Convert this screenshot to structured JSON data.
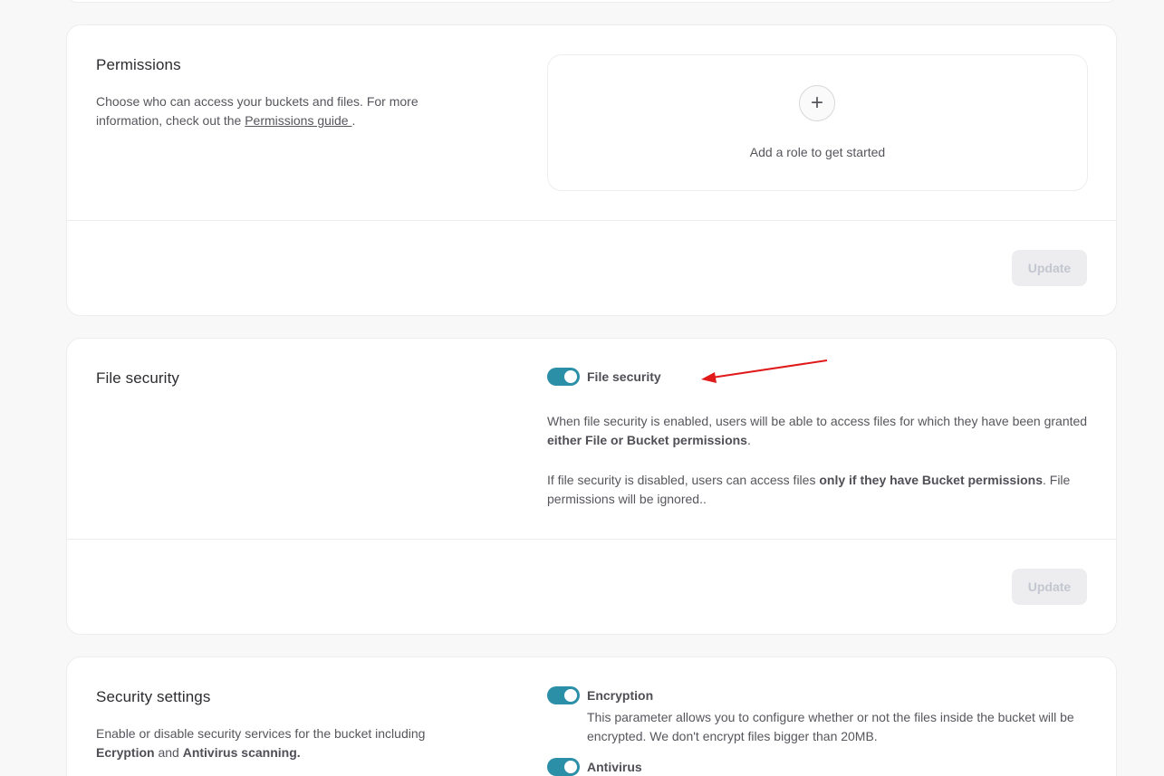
{
  "permissions": {
    "title": "Permissions",
    "desc_prefix": "Choose who can access your buckets and files. For more information, check out the ",
    "guide_link": "Permissions guide ",
    "desc_suffix": ".",
    "add_icon": "+",
    "empty_text": "Add a role to get started",
    "update_label": "Update"
  },
  "file_security": {
    "title": "File security",
    "toggle_label": "File security",
    "toggle_on": true,
    "p1_prefix": "When file security is enabled, users will be able to access files for which they have been granted ",
    "p1_bold": "either File or Bucket permissions",
    "p1_suffix": ".",
    "p2_prefix": "If file security is disabled, users can access files ",
    "p2_bold": "only if they have Bucket permissions",
    "p2_suffix": ". File permissions will be ignored..",
    "update_label": "Update"
  },
  "security_settings": {
    "title": "Security settings",
    "desc_prefix": "Enable or disable security services for the bucket including ",
    "desc_bold1": "Ecryption",
    "desc_mid": " and ",
    "desc_bold2": "Antivirus scanning.",
    "encryption_label": "Encryption",
    "encryption_on": true,
    "encryption_desc": "This parameter allows you to configure whether or not the files inside the bucket will be encrypted. We don't encrypt files bigger than 20MB.",
    "antivirus_label": "Antivirus",
    "antivirus_on": true
  },
  "colors": {
    "toggle_on": "#2b8fa8",
    "annotation_arrow": "#e0191b",
    "page_bg": "#f8f8f8"
  },
  "icons": {
    "add": "plus-icon",
    "annotation": "red-arrow-annotation"
  }
}
